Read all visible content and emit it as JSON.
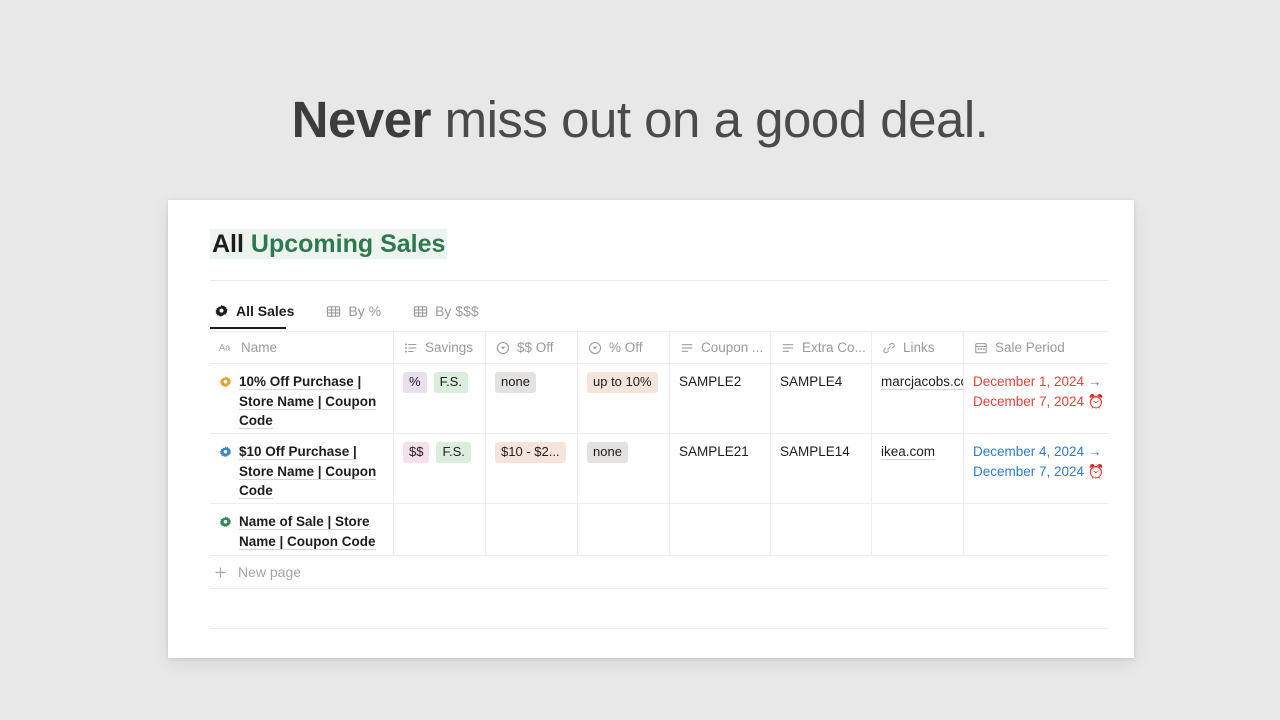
{
  "headline": {
    "strong": "Never",
    "rest": " miss out on a good deal."
  },
  "page": {
    "title_plain": "All",
    "title_accent": "Upcoming Sales"
  },
  "tabs": [
    {
      "label": "All Sales",
      "icon": "flower-gear-icon",
      "active": true
    },
    {
      "label": "By %",
      "icon": "table-icon",
      "active": false
    },
    {
      "label": "By $$$",
      "icon": "table-icon",
      "active": false
    }
  ],
  "table": {
    "columns": [
      {
        "label": "Name",
        "icon": "aa-text-icon"
      },
      {
        "label": "Savings",
        "icon": "multiselect-icon"
      },
      {
        "label": "$$ Off",
        "icon": "select-icon"
      },
      {
        "label": "% Off",
        "icon": "select-icon"
      },
      {
        "label": "Coupon ...",
        "icon": "text-lines-icon"
      },
      {
        "label": "Extra Co...",
        "icon": "text-lines-icon"
      },
      {
        "label": "Links",
        "icon": "link-icon"
      },
      {
        "label": "Sale Period",
        "icon": "calendar-icon"
      }
    ],
    "rows": [
      {
        "badge_color": "#e0a32e",
        "name": "10% Off Purchase | Store Name | Coupon Code",
        "savings": [
          "%",
          "F.S."
        ],
        "savings_styles": [
          "tag-purple",
          "tag-green"
        ],
        "dollar_off": "none",
        "dollar_off_style": "tag-gray",
        "pct_off": "up to 10%",
        "pct_off_style": "tag-salmon",
        "coupon": "SAMPLE2",
        "extra_coupon": "SAMPLE4",
        "link": "marcjacobs.co",
        "period_start": "December 1, 2024 →",
        "period_end": "December 7, 2024 ⏰",
        "period_style": "period-red"
      },
      {
        "badge_color": "#3a86c8",
        "name": "$10 Off Purchase | Store Name | Coupon Code",
        "savings": [
          "$$",
          "F.S."
        ],
        "savings_styles": [
          "tag-pink",
          "tag-green"
        ],
        "dollar_off": "$10 - $2...",
        "dollar_off_style": "tag-salmon",
        "pct_off": "none",
        "pct_off_style": "tag-gray",
        "coupon": "SAMPLE21",
        "extra_coupon": "SAMPLE14",
        "link": "ikea.com",
        "period_start": "December 4, 2024 →",
        "period_end": "December 7, 2024 ⏰",
        "period_style": "period-blue"
      },
      {
        "badge_color": "#2e8b57",
        "name": "Name of Sale | Store Name | Coupon Code",
        "savings": [],
        "savings_styles": [],
        "dollar_off": "",
        "dollar_off_style": "",
        "pct_off": "",
        "pct_off_style": "",
        "coupon": "",
        "extra_coupon": "",
        "link": "",
        "period_start": "",
        "period_end": "",
        "period_style": ""
      }
    ],
    "new_page_label": "New page"
  },
  "colors": {
    "accent_green": "#2d7a4f",
    "highlight_green": "#edf3ef",
    "period_red": "#e8403a",
    "period_blue": "#2b7cd3",
    "card_background": "#ffffff",
    "page_background": "#e8e8e8"
  }
}
